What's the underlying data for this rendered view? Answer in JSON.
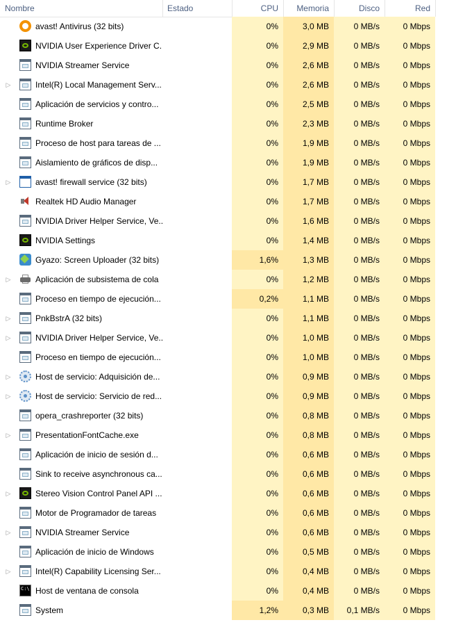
{
  "columns": {
    "name": "Nombre",
    "status": "Estado",
    "cpu": "CPU",
    "memory": "Memoria",
    "disk": "Disco",
    "network": "Red"
  },
  "processes": [
    {
      "name": "avast! Antivirus (32 bits)",
      "icon": "avast-icon",
      "expandable": false,
      "cpu": "0%",
      "mem": "3,0 MB",
      "disk": "0 MB/s",
      "net": "0 Mbps"
    },
    {
      "name": "NVIDIA User Experience Driver C...",
      "icon": "nvidia-icon",
      "expandable": false,
      "cpu": "0%",
      "mem": "2,9 MB",
      "disk": "0 MB/s",
      "net": "0 Mbps"
    },
    {
      "name": "NVIDIA Streamer Service",
      "icon": "window-icon",
      "expandable": false,
      "cpu": "0%",
      "mem": "2,6 MB",
      "disk": "0 MB/s",
      "net": "0 Mbps"
    },
    {
      "name": "Intel(R) Local Management Serv...",
      "icon": "window-icon",
      "expandable": true,
      "cpu": "0%",
      "mem": "2,6 MB",
      "disk": "0 MB/s",
      "net": "0 Mbps"
    },
    {
      "name": "Aplicación de servicios y contro...",
      "icon": "window-icon",
      "expandable": false,
      "cpu": "0%",
      "mem": "2,5 MB",
      "disk": "0 MB/s",
      "net": "0 Mbps"
    },
    {
      "name": "Runtime Broker",
      "icon": "window-icon",
      "expandable": false,
      "cpu": "0%",
      "mem": "2,3 MB",
      "disk": "0 MB/s",
      "net": "0 Mbps"
    },
    {
      "name": "Proceso de host para tareas de ...",
      "icon": "window-icon",
      "expandable": false,
      "cpu": "0%",
      "mem": "1,9 MB",
      "disk": "0 MB/s",
      "net": "0 Mbps"
    },
    {
      "name": "Aislamiento de gráficos de disp...",
      "icon": "window-icon",
      "expandable": false,
      "cpu": "0%",
      "mem": "1,9 MB",
      "disk": "0 MB/s",
      "net": "0 Mbps"
    },
    {
      "name": "avast! firewall service (32 bits)",
      "icon": "firewall-icon",
      "expandable": true,
      "cpu": "0%",
      "mem": "1,7 MB",
      "disk": "0 MB/s",
      "net": "0 Mbps"
    },
    {
      "name": "Realtek HD Audio Manager",
      "icon": "speaker-icon",
      "expandable": false,
      "cpu": "0%",
      "mem": "1,7 MB",
      "disk": "0 MB/s",
      "net": "0 Mbps"
    },
    {
      "name": "NVIDIA Driver Helper Service, Ve...",
      "icon": "window-icon",
      "expandable": false,
      "cpu": "0%",
      "mem": "1,6 MB",
      "disk": "0 MB/s",
      "net": "0 Mbps"
    },
    {
      "name": "NVIDIA Settings",
      "icon": "nvidia-icon",
      "expandable": false,
      "cpu": "0%",
      "mem": "1,4 MB",
      "disk": "0 MB/s",
      "net": "0 Mbps"
    },
    {
      "name": "Gyazo: Screen Uploader (32 bits)",
      "icon": "gyazo-icon",
      "expandable": false,
      "cpu": "1,6%",
      "mem": "1,3 MB",
      "disk": "0 MB/s",
      "net": "0 Mbps",
      "cpu_high": true
    },
    {
      "name": "Aplicación de subsistema de cola",
      "icon": "printer-icon",
      "expandable": true,
      "cpu": "0%",
      "mem": "1,2 MB",
      "disk": "0 MB/s",
      "net": "0 Mbps"
    },
    {
      "name": "Proceso en tiempo de ejecución...",
      "icon": "window-icon",
      "expandable": false,
      "cpu": "0,2%",
      "mem": "1,1 MB",
      "disk": "0 MB/s",
      "net": "0 Mbps",
      "cpu_high": true
    },
    {
      "name": "PnkBstrA (32 bits)",
      "icon": "window-icon",
      "expandable": true,
      "cpu": "0%",
      "mem": "1,1 MB",
      "disk": "0 MB/s",
      "net": "0 Mbps"
    },
    {
      "name": "NVIDIA Driver Helper Service, Ve...",
      "icon": "window-icon",
      "expandable": true,
      "cpu": "0%",
      "mem": "1,0 MB",
      "disk": "0 MB/s",
      "net": "0 Mbps"
    },
    {
      "name": "Proceso en tiempo de ejecución...",
      "icon": "window-icon",
      "expandable": false,
      "cpu": "0%",
      "mem": "1,0 MB",
      "disk": "0 MB/s",
      "net": "0 Mbps"
    },
    {
      "name": "Host de servicio: Adquisición de...",
      "icon": "gear-icon",
      "expandable": true,
      "cpu": "0%",
      "mem": "0,9 MB",
      "disk": "0 MB/s",
      "net": "0 Mbps"
    },
    {
      "name": "Host de servicio: Servicio de red...",
      "icon": "gear-icon",
      "expandable": true,
      "cpu": "0%",
      "mem": "0,9 MB",
      "disk": "0 MB/s",
      "net": "0 Mbps"
    },
    {
      "name": "opera_crashreporter (32 bits)",
      "icon": "window-icon",
      "expandable": false,
      "cpu": "0%",
      "mem": "0,8 MB",
      "disk": "0 MB/s",
      "net": "0 Mbps"
    },
    {
      "name": "PresentationFontCache.exe",
      "icon": "window-icon",
      "expandable": true,
      "cpu": "0%",
      "mem": "0,8 MB",
      "disk": "0 MB/s",
      "net": "0 Mbps"
    },
    {
      "name": "Aplicación de inicio de sesión d...",
      "icon": "window-icon",
      "expandable": false,
      "cpu": "0%",
      "mem": "0,6 MB",
      "disk": "0 MB/s",
      "net": "0 Mbps"
    },
    {
      "name": "Sink to receive asynchronous ca...",
      "icon": "window-icon",
      "expandable": false,
      "cpu": "0%",
      "mem": "0,6 MB",
      "disk": "0 MB/s",
      "net": "0 Mbps"
    },
    {
      "name": "Stereo Vision Control Panel API ...",
      "icon": "nvidia-icon",
      "expandable": true,
      "cpu": "0%",
      "mem": "0,6 MB",
      "disk": "0 MB/s",
      "net": "0 Mbps"
    },
    {
      "name": "Motor de Programador de tareas",
      "icon": "window-icon",
      "expandable": false,
      "cpu": "0%",
      "mem": "0,6 MB",
      "disk": "0 MB/s",
      "net": "0 Mbps"
    },
    {
      "name": "NVIDIA Streamer Service",
      "icon": "window-icon",
      "expandable": true,
      "cpu": "0%",
      "mem": "0,6 MB",
      "disk": "0 MB/s",
      "net": "0 Mbps"
    },
    {
      "name": "Aplicación de inicio de Windows",
      "icon": "window-icon",
      "expandable": false,
      "cpu": "0%",
      "mem": "0,5 MB",
      "disk": "0 MB/s",
      "net": "0 Mbps"
    },
    {
      "name": "Intel(R) Capability Licensing Ser...",
      "icon": "window-icon",
      "expandable": true,
      "cpu": "0%",
      "mem": "0,4 MB",
      "disk": "0 MB/s",
      "net": "0 Mbps"
    },
    {
      "name": "Host de ventana de consola",
      "icon": "console-icon",
      "expandable": false,
      "cpu": "0%",
      "mem": "0,4 MB",
      "disk": "0 MB/s",
      "net": "0 Mbps"
    },
    {
      "name": "System",
      "icon": "window-icon",
      "expandable": false,
      "cpu": "1,2%",
      "mem": "0,3 MB",
      "disk": "0,1 MB/s",
      "net": "0 Mbps",
      "cpu_high": true
    }
  ]
}
